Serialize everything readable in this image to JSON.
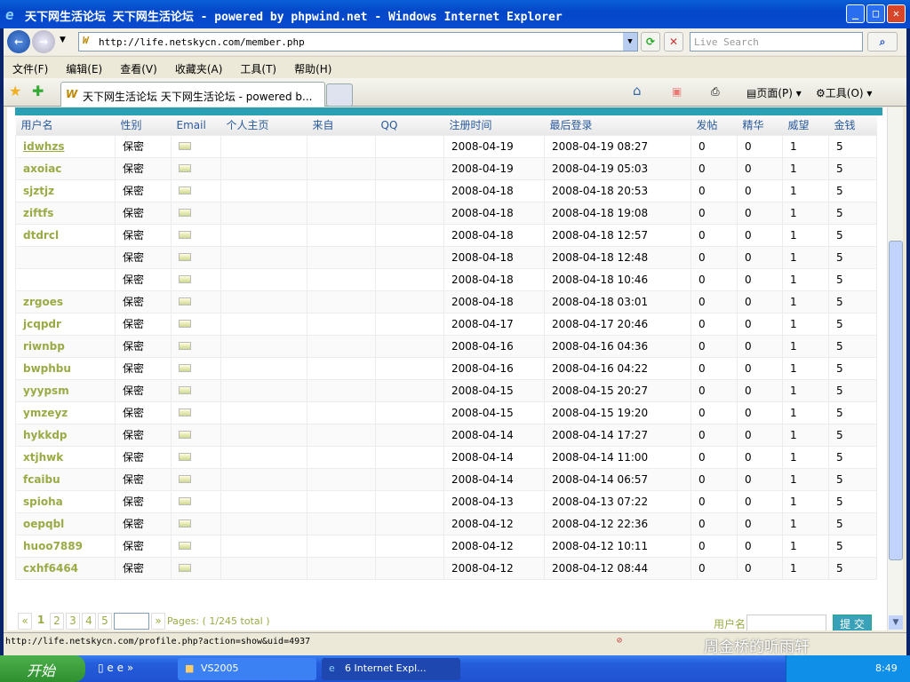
{
  "window": {
    "title": "天下网生活论坛 天下网生活论坛 - powered by phpwind.net - Windows Internet Explorer",
    "minimize": "_",
    "maximize": "□",
    "close": "✕"
  },
  "nav": {
    "back": "←",
    "forward": "→",
    "url": "http://life.netskycn.com/member.php",
    "search_placeholder": "Live Search",
    "refresh": "⟳",
    "stop": "✕",
    "search_go": "⌕"
  },
  "menu": [
    "文件(F)",
    "编辑(E)",
    "查看(V)",
    "收藏夹(A)",
    "工具(T)",
    "帮助(H)"
  ],
  "tab": {
    "title": "天下网生活论坛 天下网生活论坛 - powered b..."
  },
  "commands": {
    "home": "⌂",
    "feeds": "▣",
    "print": "⎙",
    "page": "页面(P)",
    "tools": "工具(O)"
  },
  "table": {
    "headers": [
      "用户名",
      "性别",
      "Email",
      "个人主页",
      "来自",
      "QQ",
      "注册时间",
      "最后登录",
      "发帖",
      "精华",
      "威望",
      "金钱"
    ],
    "rows": [
      [
        "idwhzs",
        "保密",
        "2008-04-19",
        "2008-04-19 08:27",
        "0",
        "0",
        "1",
        "5"
      ],
      [
        "axoiac",
        "保密",
        "2008-04-19",
        "2008-04-19 05:03",
        "0",
        "0",
        "1",
        "5"
      ],
      [
        "sjztjz",
        "保密",
        "2008-04-18",
        "2008-04-18 20:53",
        "0",
        "0",
        "1",
        "5"
      ],
      [
        "ziftfs",
        "保密",
        "2008-04-18",
        "2008-04-18 19:08",
        "0",
        "0",
        "1",
        "5"
      ],
      [
        "dtdrcl",
        "保密",
        "2008-04-18",
        "2008-04-18 12:57",
        "0",
        "0",
        "1",
        "5"
      ],
      [
        "",
        "保密",
        "2008-04-18",
        "2008-04-18 12:48",
        "0",
        "0",
        "1",
        "5"
      ],
      [
        "",
        "保密",
        "2008-04-18",
        "2008-04-18 10:46",
        "0",
        "0",
        "1",
        "5"
      ],
      [
        "zrgoes",
        "保密",
        "2008-04-18",
        "2008-04-18 03:01",
        "0",
        "0",
        "1",
        "5"
      ],
      [
        "jcqpdr",
        "保密",
        "2008-04-17",
        "2008-04-17 20:46",
        "0",
        "0",
        "1",
        "5"
      ],
      [
        "riwnbp",
        "保密",
        "2008-04-16",
        "2008-04-16 04:36",
        "0",
        "0",
        "1",
        "5"
      ],
      [
        "bwphbu",
        "保密",
        "2008-04-16",
        "2008-04-16 04:22",
        "0",
        "0",
        "1",
        "5"
      ],
      [
        "yyypsm",
        "保密",
        "2008-04-15",
        "2008-04-15 20:27",
        "0",
        "0",
        "1",
        "5"
      ],
      [
        "ymzeyz",
        "保密",
        "2008-04-15",
        "2008-04-15 19:20",
        "0",
        "0",
        "1",
        "5"
      ],
      [
        "hykkdp",
        "保密",
        "2008-04-14",
        "2008-04-14 17:27",
        "0",
        "0",
        "1",
        "5"
      ],
      [
        "xtjhwk",
        "保密",
        "2008-04-14",
        "2008-04-14 11:00",
        "0",
        "0",
        "1",
        "5"
      ],
      [
        "fcaibu",
        "保密",
        "2008-04-14",
        "2008-04-14 06:57",
        "0",
        "0",
        "1",
        "5"
      ],
      [
        "spioha",
        "保密",
        "2008-04-13",
        "2008-04-13 07:22",
        "0",
        "0",
        "1",
        "5"
      ],
      [
        "oepqbl",
        "保密",
        "2008-04-12",
        "2008-04-12 22:36",
        "0",
        "0",
        "1",
        "5"
      ],
      [
        "huoo7889",
        "保密",
        "2008-04-12",
        "2008-04-12 10:11",
        "0",
        "0",
        "1",
        "5"
      ],
      [
        "cxhf6464",
        "保密",
        "2008-04-12",
        "2008-04-12 08:44",
        "0",
        "0",
        "1",
        "5"
      ]
    ]
  },
  "pager": {
    "first": "«",
    "pages": [
      "1",
      "2",
      "3",
      "4",
      "5"
    ],
    "next": "»",
    "info": "Pages: ( 1/245 total )"
  },
  "find": {
    "label": "用户名",
    "submit": "提 交"
  },
  "status": {
    "url": "http://life.netskycn.com/profile.php?action=show&uid=4937",
    "watermark": "周金桥的听雨轩"
  },
  "taskbar": {
    "start": "开始",
    "tasks": [
      "VS2005",
      "6 Internet Expl..."
    ],
    "clock": "8:49"
  }
}
